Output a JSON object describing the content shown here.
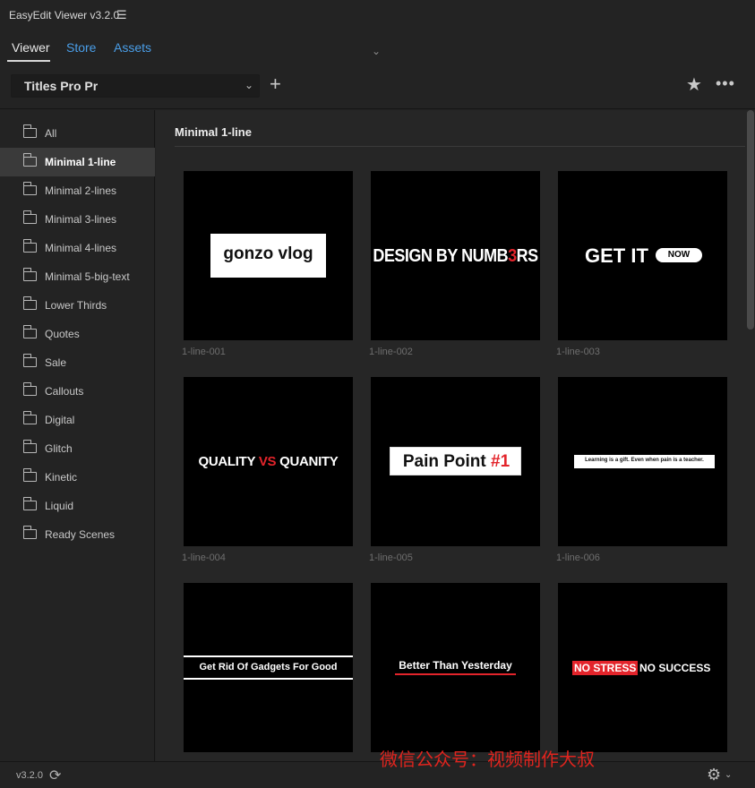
{
  "app": {
    "title": "EasyEdit Viewer v3.2.0"
  },
  "tabs": [
    {
      "label": "Viewer",
      "active": true
    },
    {
      "label": "Store",
      "active": false
    },
    {
      "label": "Assets",
      "active": false
    }
  ],
  "toolbar": {
    "collection": "Titles Pro Pr",
    "add_label": "+",
    "star_label": "★",
    "more_label": "•••"
  },
  "sidebar": {
    "items": [
      {
        "label": "All"
      },
      {
        "label": "Minimal 1-line",
        "active": true
      },
      {
        "label": "Minimal 2-lines"
      },
      {
        "label": "Minimal 3-lines"
      },
      {
        "label": "Minimal 4-lines"
      },
      {
        "label": "Minimal 5-big-text"
      },
      {
        "label": "Lower Thirds"
      },
      {
        "label": "Quotes"
      },
      {
        "label": "Sale"
      },
      {
        "label": "Callouts"
      },
      {
        "label": "Digital"
      },
      {
        "label": "Glitch"
      },
      {
        "label": "Kinetic"
      },
      {
        "label": "Liquid"
      },
      {
        "label": "Ready Scenes"
      }
    ]
  },
  "main": {
    "section_title": "Minimal 1-line",
    "cards": [
      {
        "caption": "1-line-001",
        "text": "gonzo vlog"
      },
      {
        "caption": "1-line-002",
        "text_a": "DESIGN BY NUMB",
        "text_b": "3",
        "text_c": "RS"
      },
      {
        "caption": "1-line-003",
        "text": "GET IT",
        "pill": "NOW"
      },
      {
        "caption": "1-line-004",
        "text_a": "QUALITY ",
        "text_b": "VS",
        "text_c": " QUANITY"
      },
      {
        "caption": "1-line-005",
        "text_a": "Pain Point ",
        "text_b": "#1"
      },
      {
        "caption": "1-line-006",
        "text": "Learning is a gift. Even when pain is a teacher."
      },
      {
        "caption": "",
        "text": "Get Rid Of Gadgets For Good"
      },
      {
        "caption": "",
        "text": "Better Than Yesterday"
      },
      {
        "caption": "",
        "red": "NO STRESS",
        "white": "NO SUCCESS"
      }
    ]
  },
  "status": {
    "version": "v3.2.0"
  },
  "watermark": "微信公众号：视频制作大叔",
  "colors": {
    "accent_link": "#4a9ee8",
    "brand_red": "#e3242b",
    "background": "#232323"
  }
}
